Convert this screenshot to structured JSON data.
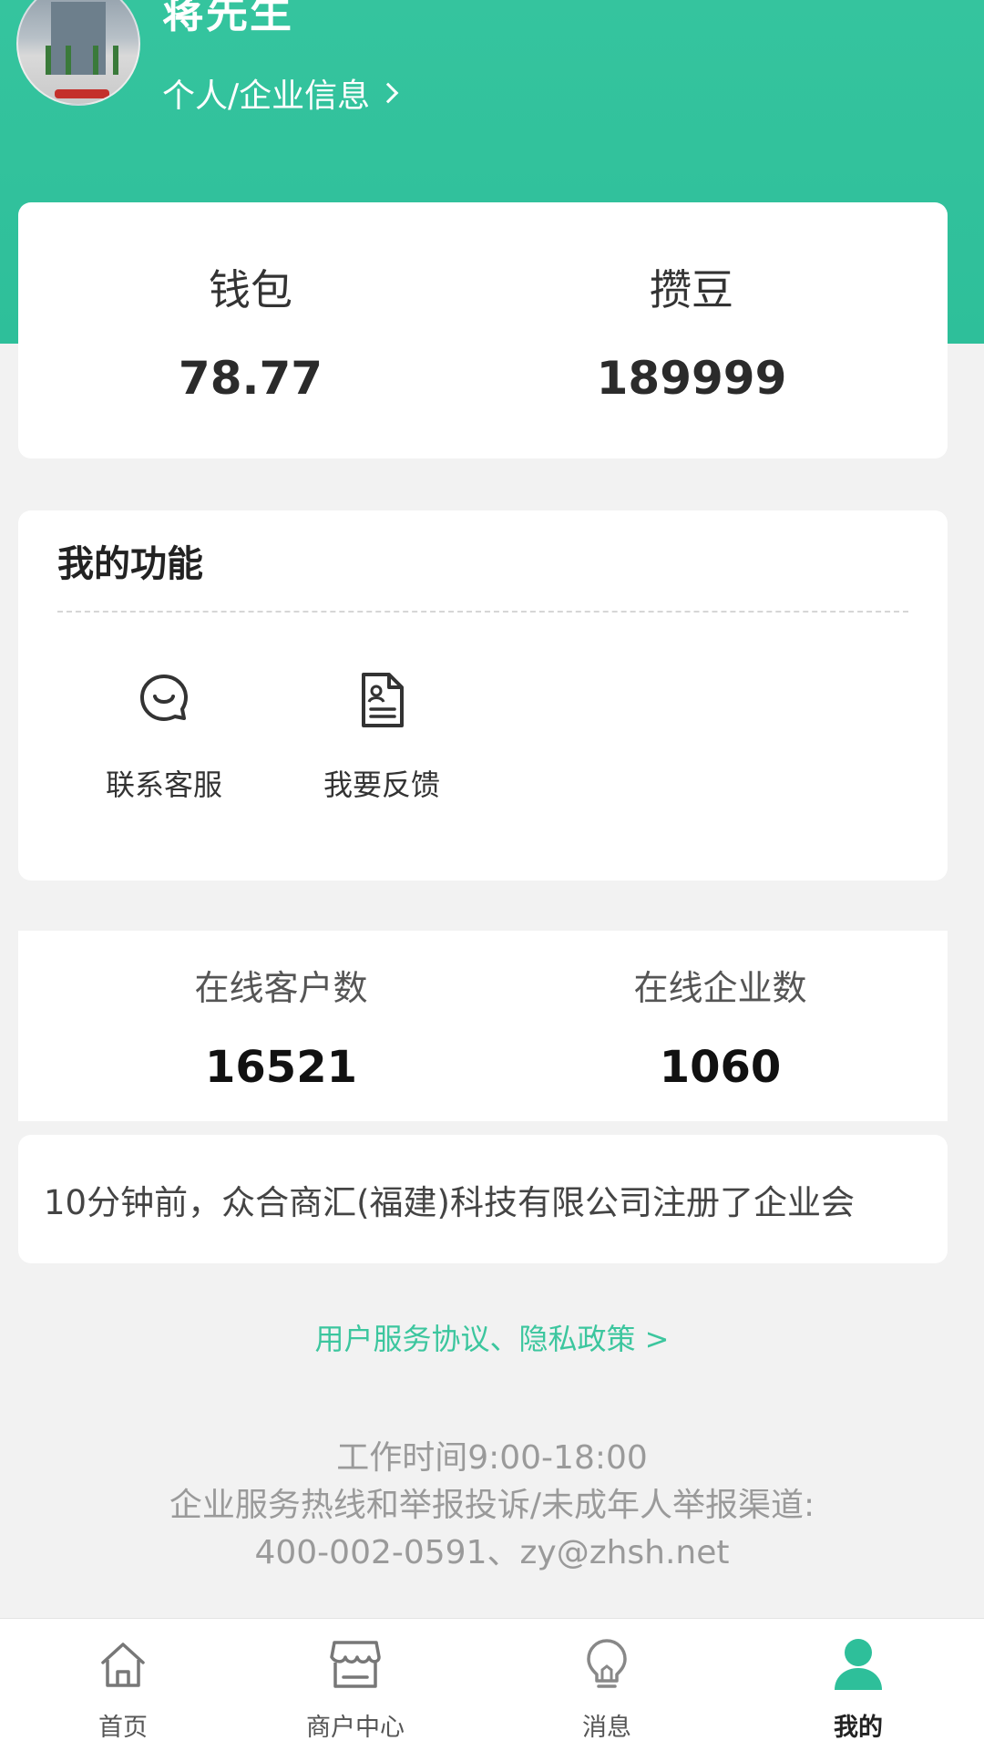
{
  "profile": {
    "name": "蒋先生",
    "info_link_label": "个人/企业信息"
  },
  "wallet": {
    "balance_label": "钱包",
    "balance_value": "78.77",
    "beans_label": "攒豆",
    "beans_value": "189999"
  },
  "functions": {
    "title": "我的功能",
    "items": [
      {
        "label": "联系客服",
        "icon": "chat-bubble-icon"
      },
      {
        "label": "我要反馈",
        "icon": "feedback-document-icon"
      }
    ]
  },
  "online_stats": {
    "customers_label": "在线客户数",
    "customers_value": "16521",
    "companies_label": "在线企业数",
    "companies_value": "1060"
  },
  "notice": {
    "text": "10分钟前，众合商汇(福建)科技有限公司注册了企业会"
  },
  "agreement": {
    "label": "用户服务协议、隐私政策 >"
  },
  "footer": {
    "hours": "工作时间9:00-18:00",
    "hotline_label": "企业服务热线和举报投诉/未成年人举报渠道:",
    "contacts": "400-002-0591、zy@zhsh.net"
  },
  "tabbar": {
    "items": [
      {
        "label": "首页",
        "icon": "home-icon",
        "active": false
      },
      {
        "label": "商户中心",
        "icon": "store-icon",
        "active": false
      },
      {
        "label": "消息",
        "icon": "lightbulb-icon",
        "active": false
      },
      {
        "label": "我的",
        "icon": "user-icon",
        "active": true
      }
    ]
  },
  "colors": {
    "brand": "#2ebf9a",
    "link": "#3cc69e",
    "background": "#f2f2f2"
  }
}
